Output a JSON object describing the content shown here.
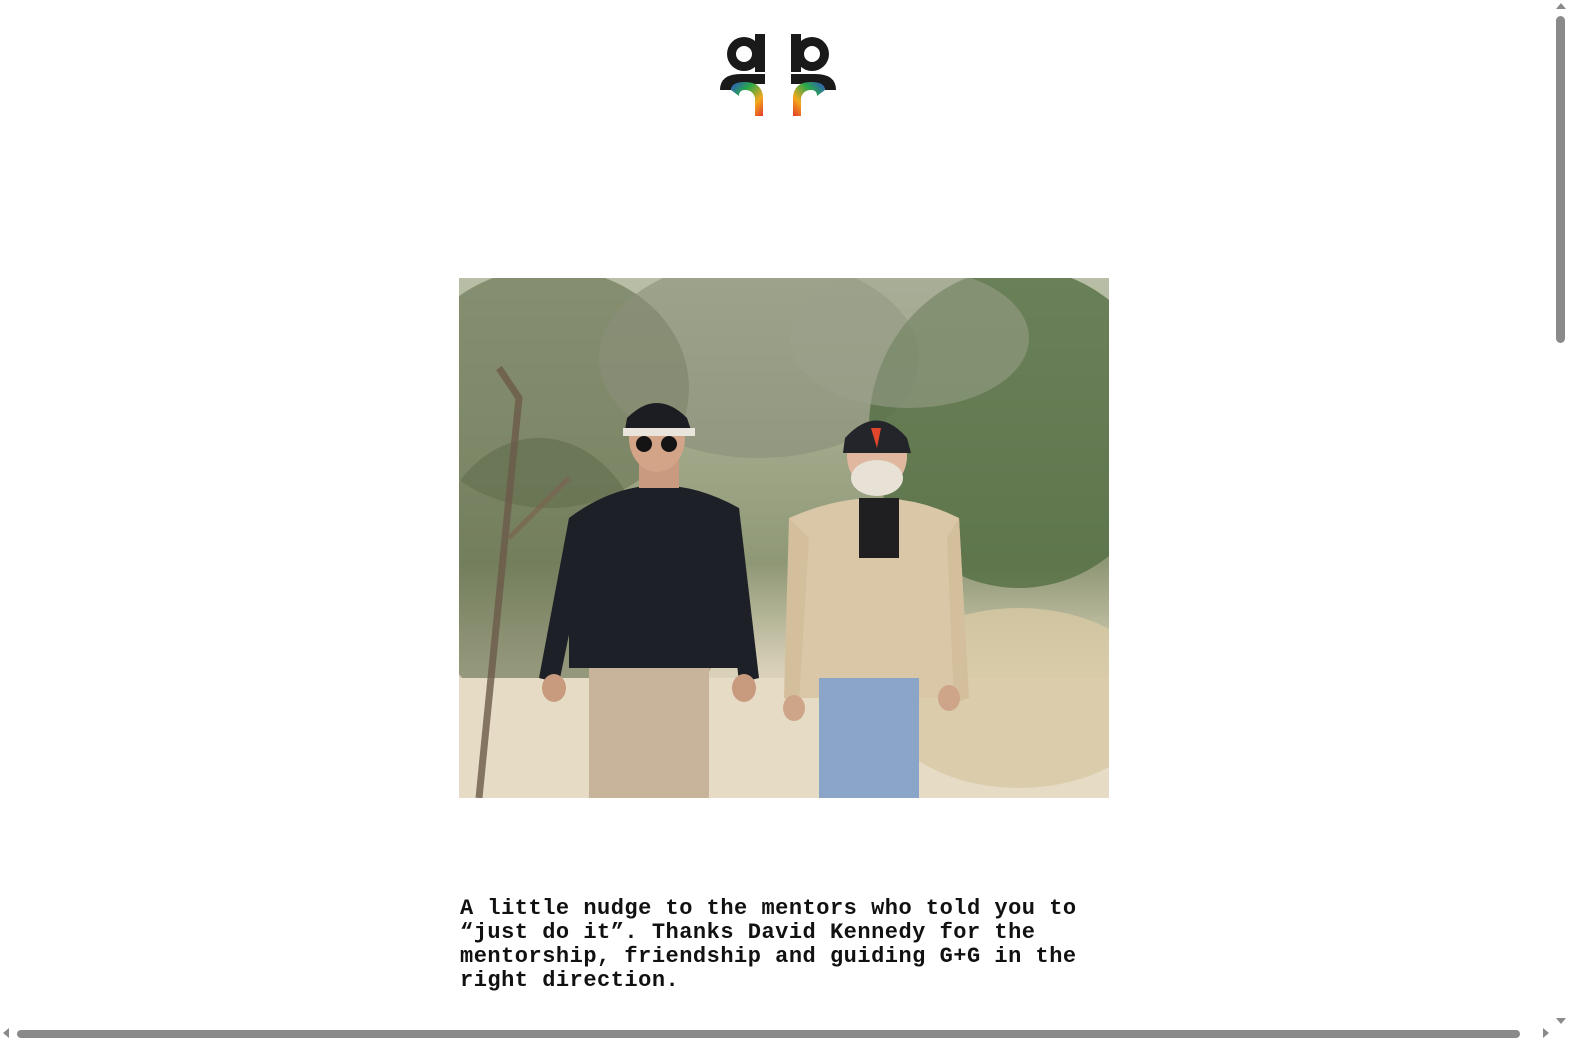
{
  "logo": {
    "icon": "gg-logo-icon",
    "colors": [
      "#1a1a1a",
      "#2aa84a",
      "#2f55c9",
      "#e43a2a",
      "#f2a81d"
    ]
  },
  "photo": {
    "icon": "photo-two-men-walking"
  },
  "caption": {
    "text": "A little nudge to the mentors who told you to “just do it”. Thanks David Kennedy for the mentorship, friendship and guiding G+G in the right direction."
  },
  "scrollbars": {
    "vertical_position": 0.0,
    "horizontal_position": 0.0
  }
}
